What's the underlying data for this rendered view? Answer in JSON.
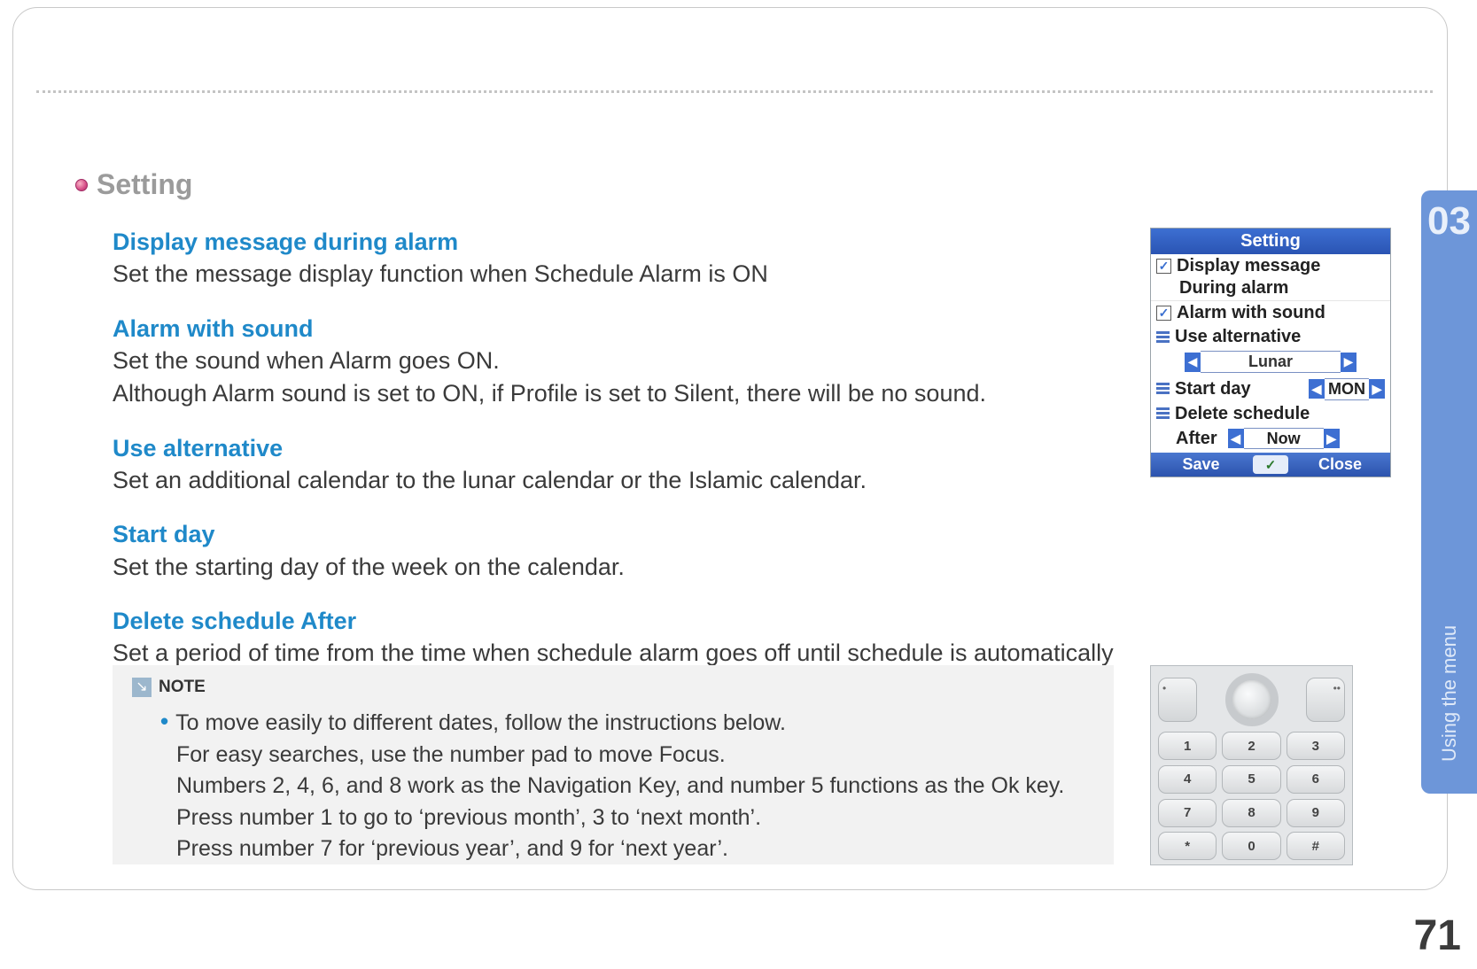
{
  "section_title": "Setting",
  "items": [
    {
      "title": "Display message during alarm",
      "body": "Set the message display function when Schedule Alarm is ON"
    },
    {
      "title": "Alarm with sound",
      "body": "Set the sound when Alarm goes ON.\nAlthough Alarm sound is set to ON, if Profile is set to Silent, there will be no sound."
    },
    {
      "title": "Use alternative",
      "body": "Set an additional calendar to the lunar calendar or the Islamic calendar."
    },
    {
      "title": "Start day",
      "body": "Set the starting day of the week on the calendar."
    },
    {
      "title": "Delete schedule After",
      "body": "Set a period of time from the time when schedule alarm goes off until schedule is automatically deleted."
    }
  ],
  "note": {
    "label": "NOTE",
    "lines": [
      "To move easily to different dates, follow the instructions below.",
      "For easy searches, use the number pad to move Focus.",
      "Numbers 2, 4, 6, and 8 work as the Navigation Key, and number 5 functions as the Ok key.",
      "Press number 1 to go to ‘previous month’, 3 to ‘next month’.",
      "Press number 7 for ‘previous   year’, and 9 for ‘next year’."
    ]
  },
  "side_tab": {
    "chapter": "03",
    "label": "Using the menu"
  },
  "page_number": "71",
  "device_screen": {
    "title": "Setting",
    "display_message_line1": "Display message",
    "display_message_line2": "During alarm",
    "display_message_checked": true,
    "alarm_with_sound": "Alarm with sound",
    "alarm_with_sound_checked": true,
    "use_alternative": "Use alternative",
    "use_alternative_value": "Lunar",
    "start_day": "Start day",
    "start_day_value": "MON",
    "delete_schedule": "Delete schedule",
    "delete_after_label": "After",
    "delete_after_value": "Now",
    "softkeys": {
      "left": "Save",
      "mid": "✓",
      "right": "Close"
    }
  },
  "keypad": {
    "keys": [
      "1",
      "2",
      "3",
      "4",
      "5",
      "6",
      "7",
      "8",
      "9",
      "*",
      "0",
      "#"
    ]
  }
}
